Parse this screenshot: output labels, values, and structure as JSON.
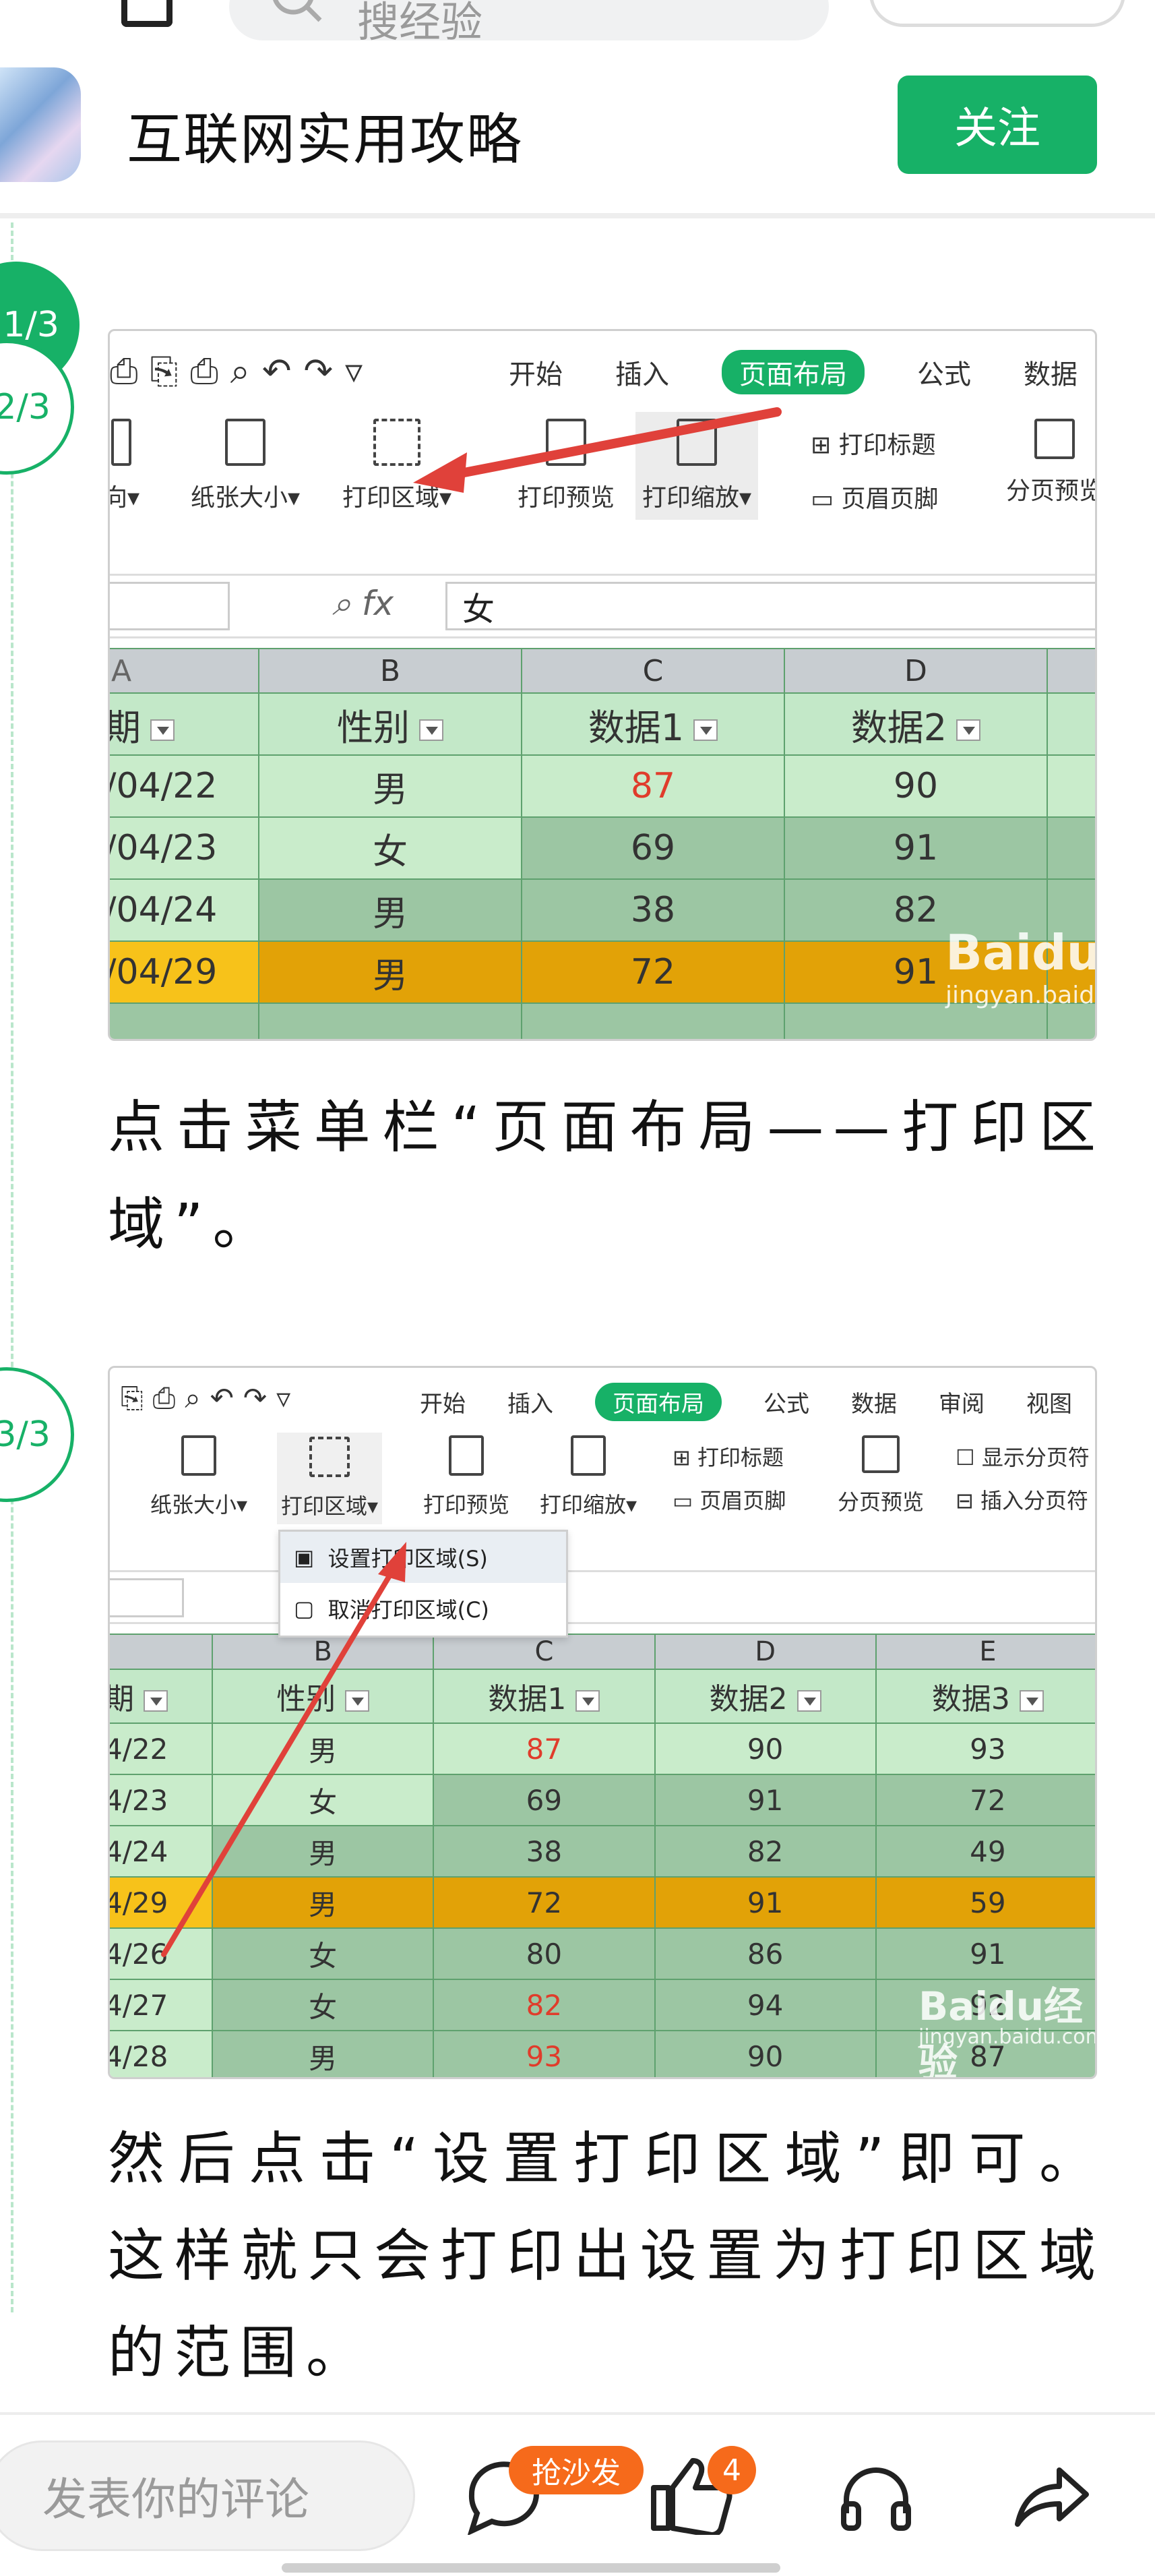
{
  "search": {
    "placeholder": "搜经验"
  },
  "header": {
    "author": "互联网实用攻略",
    "follow_label": "关注"
  },
  "steps": {
    "step1_badge": "1/3",
    "step2_badge": "2/3",
    "step3_badge": "3/3"
  },
  "step2": {
    "ribbon_tabs": [
      "开始",
      "插入",
      "页面布局",
      "公式",
      "数据"
    ],
    "tools": [
      "向",
      "纸张大小",
      "打印区域",
      "打印预览",
      "打印缩放",
      "打印标题",
      "页眉页脚",
      "分页预览"
    ],
    "formula_value": "女",
    "fx": "fx",
    "col_letters": [
      "A",
      "B",
      "C",
      "D"
    ],
    "headers": [
      "期",
      "性别",
      "数据1",
      "数据2"
    ],
    "rows": [
      [
        "/04/22",
        "男",
        "87",
        "90"
      ],
      [
        "/04/23",
        "女",
        "69",
        "91"
      ],
      [
        "/04/24",
        "男",
        "38",
        "82"
      ],
      [
        "/04/29",
        "男",
        "72",
        "91"
      ]
    ],
    "watermark": "Baidu",
    "watermark_sub": "jingyan.baidu"
  },
  "step2_caption": "点击菜单栏“页面布局——打印区域”。",
  "step3": {
    "ribbon_tabs": [
      "开始",
      "插入",
      "页面布局",
      "公式",
      "数据",
      "审阅",
      "视图"
    ],
    "tools": [
      "纸张大小",
      "打印区域",
      "打印预览",
      "打印缩放",
      "打印标题",
      "页眉页脚",
      "分页预览",
      "显示分页符",
      "插入分页符"
    ],
    "menu": [
      "设置打印区域(S)",
      "取消打印区域(C)"
    ],
    "col_letters": [
      "B",
      "C",
      "D",
      "E"
    ],
    "headers": [
      "期",
      "性别",
      "数据1",
      "数据2",
      "数据3"
    ],
    "rows": [
      [
        "4/22",
        "男",
        "87",
        "90",
        "93"
      ],
      [
        "4/23",
        "女",
        "69",
        "91",
        "72"
      ],
      [
        "4/24",
        "男",
        "38",
        "82",
        "49"
      ],
      [
        "4/29",
        "男",
        "72",
        "91",
        "59"
      ],
      [
        "4/26",
        "女",
        "80",
        "86",
        "91"
      ],
      [
        "4/27",
        "女",
        "82",
        "94",
        "92"
      ],
      [
        "4/28",
        "男",
        "93",
        "90",
        "87"
      ]
    ],
    "watermark": "Baidu经验",
    "watermark_sub": "jingyan.baidu.com"
  },
  "step3_caption": "然后点击“设置打印区域”即可。这样就只会打印出设置为打印区域的范围。",
  "bottom": {
    "comment_placeholder": "发表你的评论",
    "sofa_badge": "抢沙发",
    "like_count": "4"
  },
  "colors": {
    "brand_green": "#17b167",
    "badge_orange": "#f66a1b",
    "highlight_orange": "#e2a207"
  },
  "icons": [
    "search-icon",
    "menu-icon",
    "comment-icon",
    "like-icon",
    "headphones-icon",
    "share-icon"
  ]
}
